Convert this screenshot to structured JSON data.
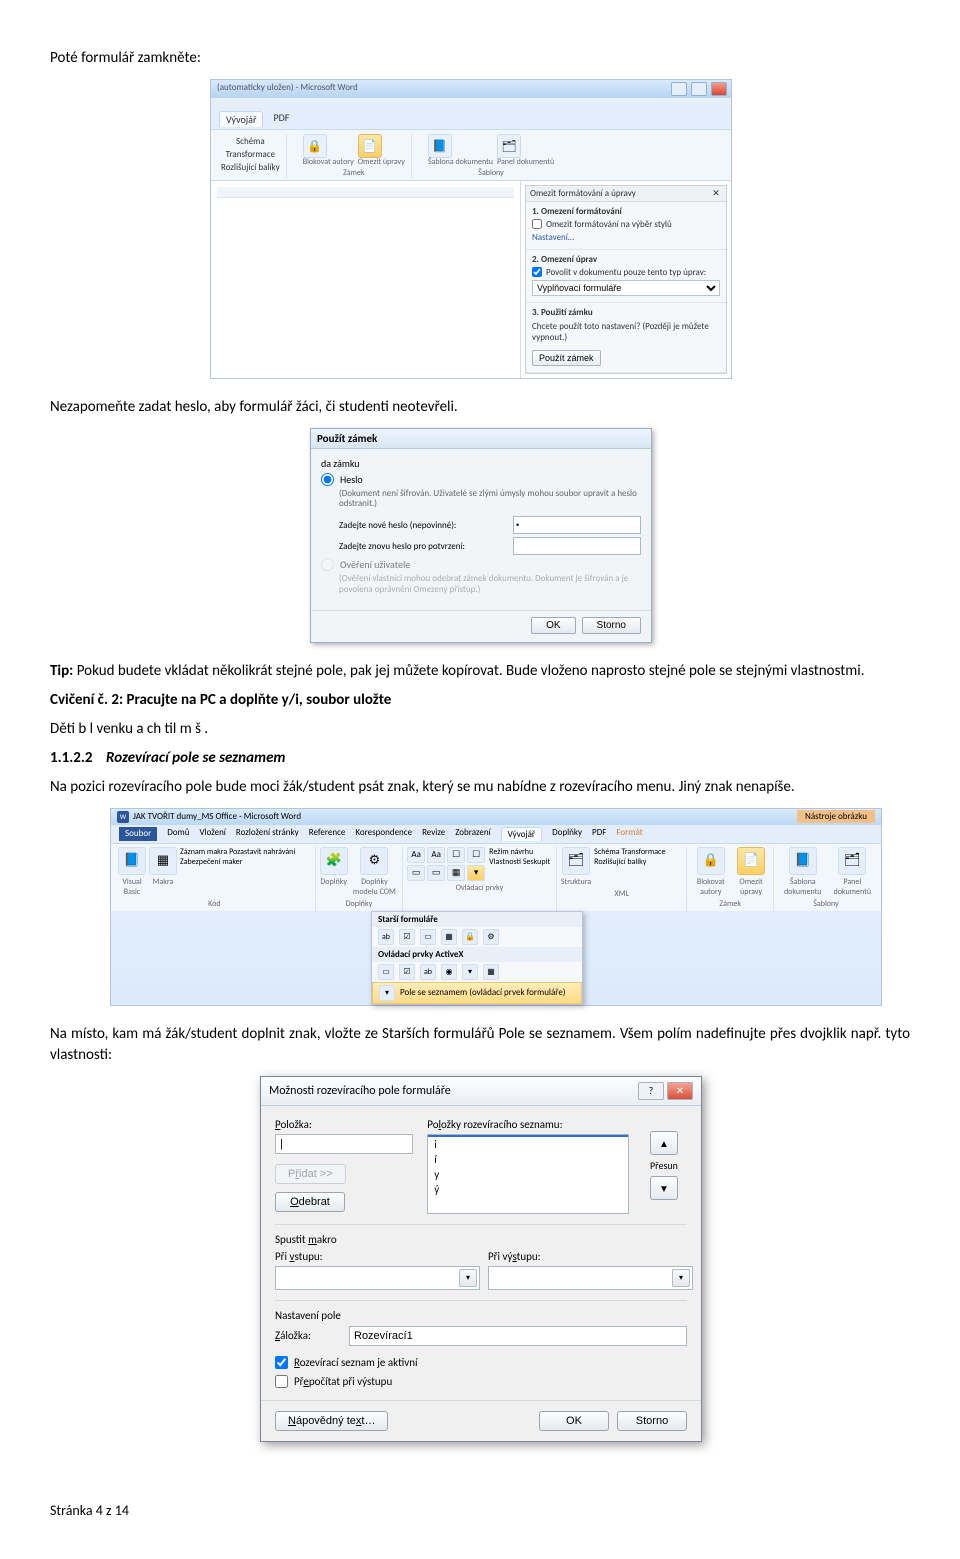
{
  "p1": "Poté formulář zamkněte:",
  "shot1": {
    "titlebar": "(automaticky uložen) - Microsoft Word",
    "tabs": [
      "Vývojář",
      "PDF"
    ],
    "group_left": {
      "items": [
        "Schéma",
        "Transformace",
        "Rozlišující balíky"
      ],
      "label": ""
    },
    "group_lock": {
      "btn1": "Blokovat autory",
      "btn2": "Omezit úpravy",
      "label": "Zámek"
    },
    "group_tmpl": {
      "btn1": "Šablona dokumentu",
      "btn2": "Panel dokumentů",
      "label": "Šablony"
    },
    "pane": {
      "title": "Omezit formátování a úpravy",
      "s1_title": "1. Omezení formátování",
      "s1_cb": "Omezit formátování na výběr stylů",
      "s1_link": "Nastavení…",
      "s2_title": "2. Omezení úprav",
      "s2_cb": "Povolit v dokumentu pouze tento typ úprav:",
      "s2_sel": "Vyplňovací formuláře",
      "s3_title": "3. Použití zámku",
      "s3_text": "Chcete použít toto nastavení? (Později je můžete vypnout.)",
      "s3_btn": "Použít zámek"
    }
  },
  "p2": "Nezapomeňte zadat heslo, aby formulář žáci, či studenti neotevřeli.",
  "shot2": {
    "title": "Použít zámek",
    "method": "da zámku",
    "r1": "Heslo",
    "r1_desc": "(Dokument není šifrován. Uživatelé se zlými úmysly mohou soubor upravit a heslo odstranit.)",
    "f1": "Zadejte nové heslo (nepovinné):",
    "f2": "Zadejte znovu heslo pro potvrzení:",
    "r2": "Ověření uživatele",
    "r2_desc": "(Ověření vlastníci mohou odebrat zámek dokumentu. Dokument je šifrován a je povolena oprávnění Omezený přístup.)",
    "ok": "OK",
    "cancel": "Storno"
  },
  "p3": {
    "tip": "Tip:",
    "rest": " Pokud budete vkládat několikrát stejné pole, pak jej můžete kopírovat. Bude vloženo naprosto stejné pole se stejnými vlastnostmi."
  },
  "ex2": "Cvičení č. 2: Pracujte na PC a doplňte y/i, soubor uložte",
  "ex2_text": "Děti b   l    venku a ch    til    m    š   .",
  "h_num": "1.1.2.2",
  "h_title": "Rozevírací pole se seznamem",
  "p4": "Na pozici rozevíracího pole bude moci žák/student psát znak, který se mu nabídne z rozevíracího menu. Jiný znak nenapíše.",
  "shot3": {
    "app_title": "JAK TVOŘIT dumy_MS Office - Microsoft Word",
    "tool_header": "Nástroje obrázku",
    "tabs": [
      "Soubor",
      "Domů",
      "Vložení",
      "Rozložení stránky",
      "Reference",
      "Korespondence",
      "Revize",
      "Zobrazení",
      "Vývojář",
      "Doplňky",
      "PDF",
      "Formát"
    ],
    "active_tab": "Vývojář",
    "g_kod": {
      "big": "Visual Basic",
      "big2": "Makra",
      "items": [
        "Záznam makra",
        "Pozastavit nahrávání",
        "Zabezpečení maker"
      ],
      "label": "Kód"
    },
    "g_dopl": {
      "b1": "Doplňky",
      "b2": "Doplňky modelu COM",
      "label": "Doplňky"
    },
    "g_ovl": {
      "items": [
        "Aa",
        "Aa",
        "☐",
        "☐",
        "▭",
        "▭",
        "▦",
        "▭"
      ],
      "side": [
        "Režim návrhu",
        "Vlastnosti",
        "Seskupit"
      ],
      "label": "Ovládací prvky"
    },
    "g_xml": {
      "b": "Struktura",
      "items": [
        "Schéma",
        "Transformace",
        "Rozlišující balíky"
      ],
      "label": "XML"
    },
    "g_lock": {
      "b1": "Blokovat autory",
      "b2": "Omezit úpravy",
      "label": "Zámek"
    },
    "g_tmpl": {
      "b1": "Šablona dokumentu",
      "b2": "Panel dokumentů",
      "label": "Šablony"
    },
    "dd": {
      "head": "Starší formuláře",
      "item_hl": "Pole se seznamem (ovládací prvek formuláře)",
      "head2": "Ovládací prvky ActiveX"
    }
  },
  "p5": "Na místo, kam má žák/student doplnit znak, vložte ze Starších formulářů Pole se seznamem. Všem polím nadefinujte přes dvojklik např. tyto vlastnosti:",
  "shot4": {
    "title": "Možnosti rozevíracího pole formuláře",
    "lbl_polozka": "Položka:",
    "lbl_polozka_u": "P",
    "lbl_seznam": "Položky rozevíracího seznamu:",
    "lbl_seznam_u": "l",
    "btn_pridat": "Přidat >>",
    "btn_pridat_u": "ř",
    "btn_odebrat": "Odebrat",
    "btn_odebrat_u": "O",
    "btn_presun": "Přesun",
    "lbl_spustit": "Spustit makro",
    "lbl_spustit_u": "m",
    "lbl_pri_vstupu": "Při vstupu:",
    "lbl_pri_vstupu_u": "v",
    "lbl_pri_vystupu": "Při výstupu:",
    "lbl_pri_vystupu_u": "s",
    "lbl_nast": "Nastavení pole",
    "lbl_zalozka": "Záložka:",
    "lbl_zalozka_u": "Z",
    "val_zalozka": "Rozevírací1",
    "cb1": "Rozevírací seznam je aktivní",
    "cb1_u": "R",
    "cb2": "Přepočítat při výstupu",
    "cb2_u": "e",
    "btn_napoveda": "Nápovědný text…",
    "btn_napoveda_u": "N",
    "btn_ok": "OK",
    "btn_storno": "Storno",
    "list_items": [
      "",
      "i",
      "í",
      "y",
      "ý"
    ]
  },
  "footer": "Stránka 4 z 14"
}
